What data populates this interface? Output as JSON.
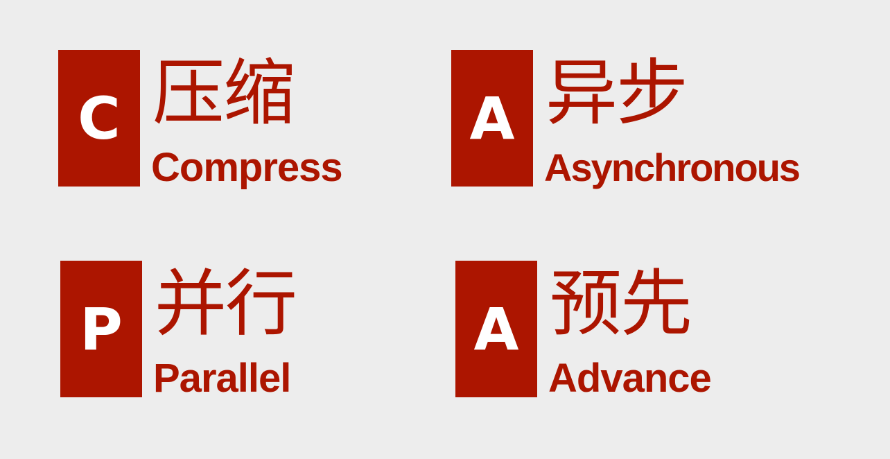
{
  "accent_color": "#ac1500",
  "background_color": "#ededed",
  "items": [
    {
      "letter": "C",
      "chinese": "压缩",
      "english": "Compress"
    },
    {
      "letter": "A",
      "chinese": "异步",
      "english": "Asynchronous"
    },
    {
      "letter": "P",
      "chinese": "并行",
      "english": "Parallel"
    },
    {
      "letter": "A",
      "chinese": "预先",
      "english": "Advance"
    }
  ]
}
